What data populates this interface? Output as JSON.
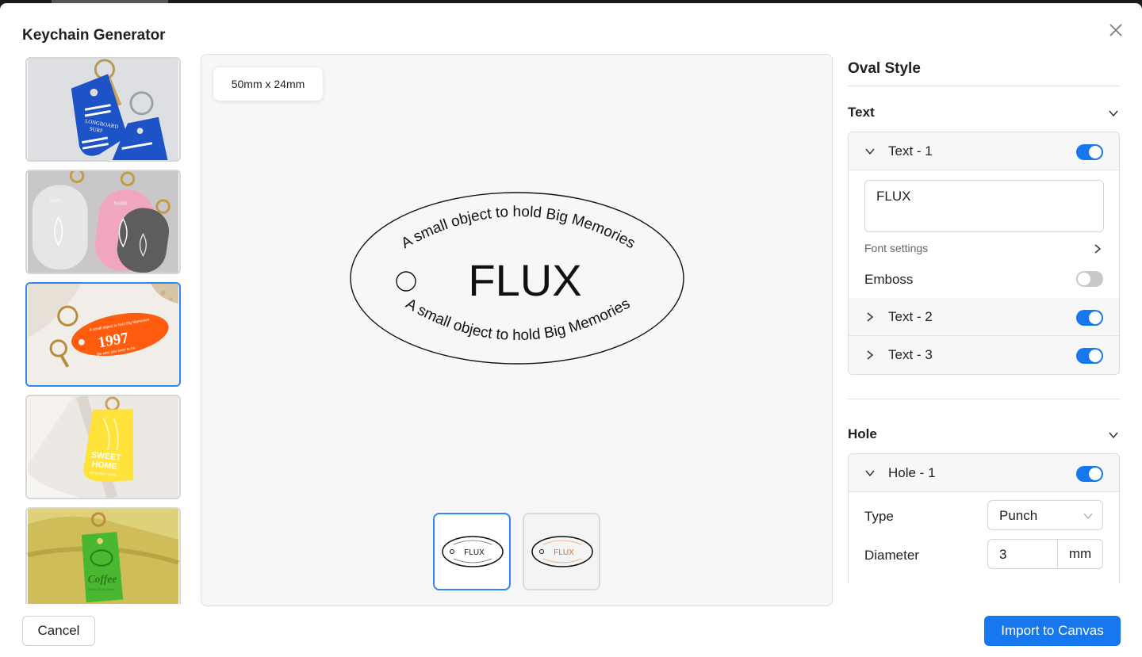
{
  "dialog": {
    "title": "Keychain Generator",
    "close_icon": "close-icon"
  },
  "templates": [
    {
      "name": "motel-tag-blue",
      "selected": false,
      "lines": [
        "LONGBOARD",
        "SURF"
      ]
    },
    {
      "name": "clear-oval-trio",
      "selected": false,
      "lines": [
        "SOUL",
        "NAME"
      ]
    },
    {
      "name": "orange-oval",
      "selected": true,
      "lines": [
        "1997",
        "A small object to hold Big Memories",
        "Be who you want to be."
      ]
    },
    {
      "name": "yellow-tag",
      "selected": false,
      "lines": [
        "SWEET",
        "HOME",
        "Home Sweet Home"
      ]
    },
    {
      "name": "green-tag",
      "selected": false,
      "lines": [
        "Coffee",
        "INDULGE SLOWLY"
      ]
    }
  ],
  "preview": {
    "size_label": "50mm x 24mm",
    "main_text": "FLUX",
    "arc_top_text": "A small object to hold Big Memories",
    "arc_bottom_text": "A small object to hold Big Memories",
    "variants": [
      {
        "name": "black",
        "selected": true,
        "color": "#111111"
      },
      {
        "name": "orange",
        "selected": false,
        "color": "#e06b2a"
      }
    ]
  },
  "panel": {
    "title": "Oval Style",
    "text_section": {
      "label": "Text",
      "items": [
        {
          "label": "Text - 1",
          "expanded": true,
          "enabled": true
        },
        {
          "label": "Text - 2",
          "expanded": false,
          "enabled": true
        },
        {
          "label": "Text - 3",
          "expanded": false,
          "enabled": true
        }
      ],
      "text1_value": "FLUX",
      "font_settings_label": "Font settings",
      "emboss_label": "Emboss",
      "emboss_enabled": false
    },
    "hole_section": {
      "label": "Hole",
      "item_label": "Hole - 1",
      "item_enabled": true,
      "type_label": "Type",
      "type_value": "Punch",
      "diameter_label": "Diameter",
      "diameter_value": "3",
      "diameter_unit": "mm"
    }
  },
  "footer": {
    "cancel_label": "Cancel",
    "import_label": "Import to Canvas"
  },
  "colors": {
    "accent": "#1677ee",
    "selected_border": "#2f87ef"
  }
}
